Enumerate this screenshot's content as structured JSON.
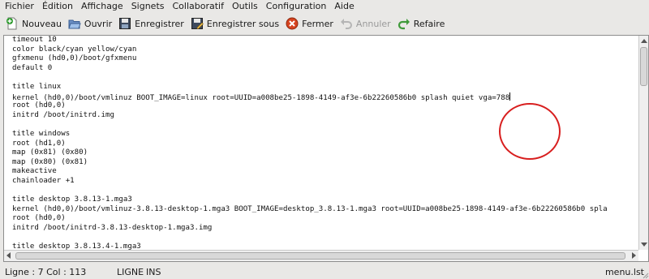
{
  "menu": {
    "items": [
      "Fichier",
      "Édition",
      "Affichage",
      "Signets",
      "Collaboratif",
      "Outils",
      "Configuration",
      "Aide"
    ]
  },
  "toolbar": {
    "new_label": "Nouveau",
    "open_label": "Ouvrir",
    "save_label": "Enregistrer",
    "save_as_label": "Enregistrer sous",
    "close_label": "Fermer",
    "undo_label": "Annuler",
    "redo_label": "Refaire",
    "icons": {
      "new": "new-document-icon",
      "open": "open-folder-icon",
      "save": "save-disk-icon",
      "save_as": "save-as-icon",
      "close": "close-icon",
      "undo": "undo-icon",
      "redo": "redo-icon"
    },
    "colors": {
      "close": "#d6431f",
      "redo": "#3f9a3a",
      "new_plus": "#2e9b2e"
    }
  },
  "editor": {
    "lines": [
      "timeout 10",
      "color black/cyan yellow/cyan",
      "gfxmenu (hd0,0)/boot/gfxmenu",
      "default 0",
      "",
      "title linux",
      "kernel (hd0,0)/boot/vmlinuz BOOT_IMAGE=linux root=UUID=a008be25-1898-4149-af3e-6b22260586b0 splash quiet vga=788",
      "root (hd0,0)",
      "initrd /boot/initrd.img",
      "",
      "title windows",
      "root (hd1,0)",
      "map (0x81) (0x80)",
      "map (0x80) (0x81)",
      "makeactive",
      "chainloader +1",
      "",
      "title desktop 3.8.13-1.mga3",
      "kernel (hd0,0)/boot/vmlinuz-3.8.13-desktop-1.mga3 BOOT_IMAGE=desktop_3.8.13-1.mga3 root=UUID=a008be25-1898-4149-af3e-6b22260586b0 spla",
      "root (hd0,0)",
      "initrd /boot/initrd-3.8.13-desktop-1.mga3.img",
      "",
      "title desktop 3.8.13.4-1.mga3"
    ],
    "annotation_color": "#d81f1f"
  },
  "status": {
    "position": "Ligne : 7 Col : 113",
    "mode": "LIGNE",
    "insert": "INS",
    "filename": "menu.lst"
  }
}
